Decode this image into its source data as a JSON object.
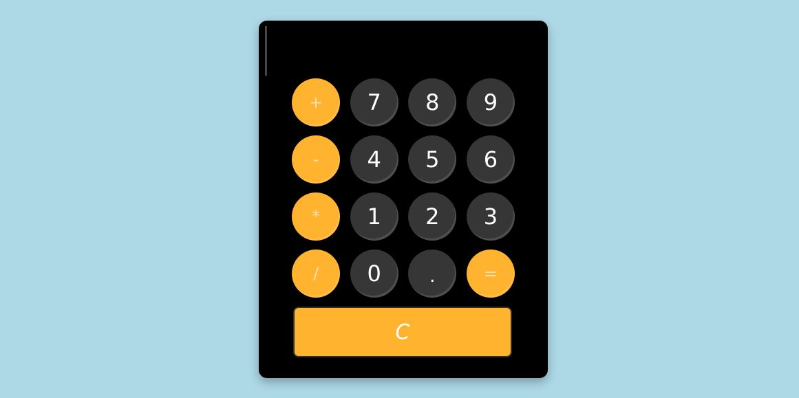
{
  "display": {
    "value": ""
  },
  "keys": [
    {
      "label": "+",
      "kind": "op"
    },
    {
      "label": "7",
      "kind": "num"
    },
    {
      "label": "8",
      "kind": "num"
    },
    {
      "label": "9",
      "kind": "num"
    },
    {
      "label": "-",
      "kind": "op"
    },
    {
      "label": "4",
      "kind": "num"
    },
    {
      "label": "5",
      "kind": "num"
    },
    {
      "label": "6",
      "kind": "num"
    },
    {
      "label": "*",
      "kind": "op"
    },
    {
      "label": "1",
      "kind": "num"
    },
    {
      "label": "2",
      "kind": "num"
    },
    {
      "label": "3",
      "kind": "num"
    },
    {
      "label": "/",
      "kind": "op"
    },
    {
      "label": "0",
      "kind": "num"
    },
    {
      "label": ".",
      "kind": "num"
    },
    {
      "label": "=",
      "kind": "op"
    }
  ],
  "clear_label": "C",
  "colors": {
    "page_background": "#add8e6",
    "calculator_body": "#000000",
    "number_key": "#363636",
    "operator_key": "#ffb32f",
    "operator_text": "#f5deb3",
    "number_text": "#ffffff"
  }
}
